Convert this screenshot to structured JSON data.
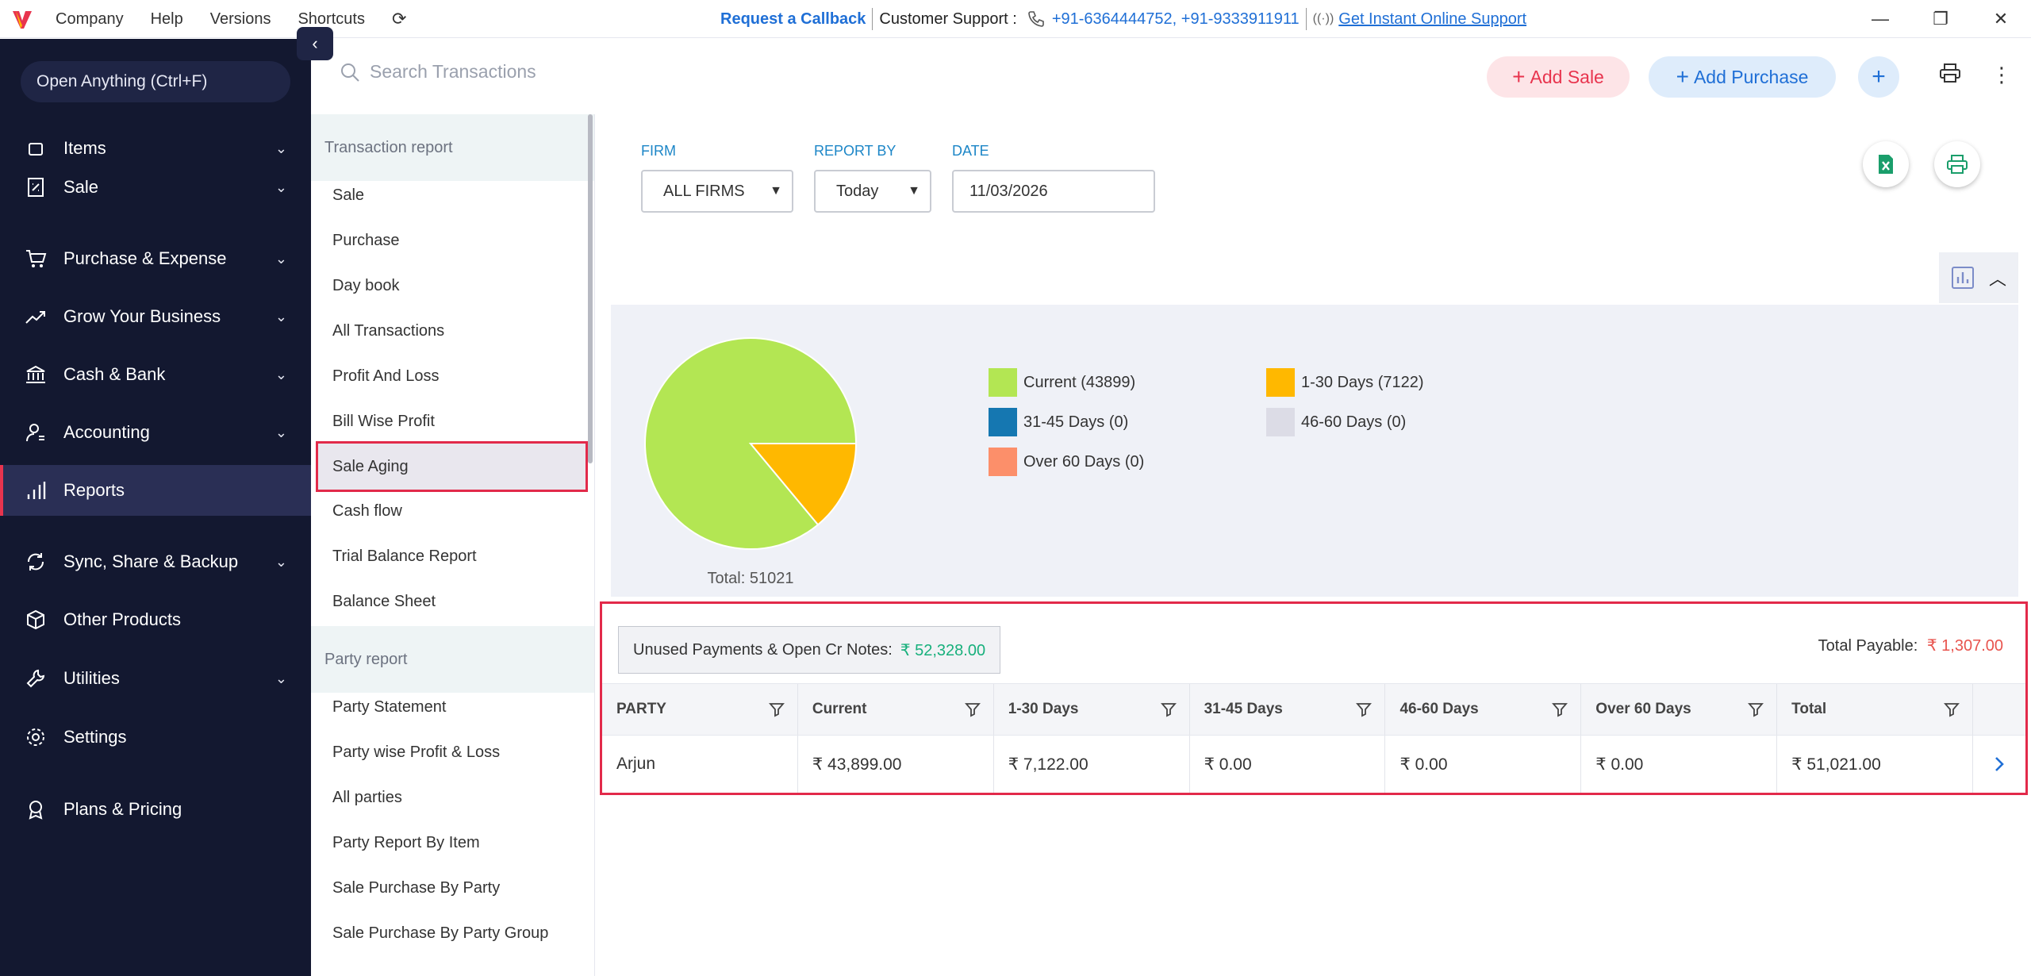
{
  "topbar": {
    "menu": [
      "Company",
      "Help",
      "Versions",
      "Shortcuts"
    ],
    "request_callback": "Request a Callback",
    "support_label": "Customer Support :",
    "support_phones": "+91-6364444752, +91-9333911911",
    "online_support": "Get Instant Online Support"
  },
  "sidebar": {
    "open_anything": "Open Anything (Ctrl+F)",
    "items": [
      {
        "label": "Items",
        "icon": "box-icon"
      },
      {
        "label": "Sale",
        "icon": "receipt-icon"
      },
      {
        "label": "Purchase & Expense",
        "icon": "cart-icon"
      },
      {
        "label": "Grow Your Business",
        "icon": "trend-icon"
      },
      {
        "label": "Cash & Bank",
        "icon": "bank-icon"
      },
      {
        "label": "Accounting",
        "icon": "person-icon"
      },
      {
        "label": "Reports",
        "icon": "bar-chart-icon"
      },
      {
        "label": "Sync, Share & Backup",
        "icon": "sync-icon"
      },
      {
        "label": "Other Products",
        "icon": "cube-icon"
      },
      {
        "label": "Utilities",
        "icon": "wrench-icon"
      },
      {
        "label": "Settings",
        "icon": "gear-icon"
      },
      {
        "label": "Plans & Pricing",
        "icon": "award-icon"
      }
    ]
  },
  "search": {
    "placeholder": "Search Transactions"
  },
  "actions": {
    "add_sale": "Add Sale",
    "add_purchase": "Add Purchase"
  },
  "subnav": {
    "transaction_header": "Transaction report",
    "transaction_items": [
      "Sale",
      "Purchase",
      "Day book",
      "All Transactions",
      "Profit And Loss",
      "Bill Wise Profit",
      "Sale Aging",
      "Cash flow",
      "Trial Balance Report",
      "Balance Sheet"
    ],
    "party_header": "Party report",
    "party_items": [
      "Party Statement",
      "Party wise Profit & Loss",
      "All parties",
      "Party Report By Item",
      "Sale Purchase By Party",
      "Sale Purchase By Party Group"
    ]
  },
  "filters": {
    "firm_label": "FIRM",
    "firm_value": "ALL FIRMS",
    "report_by_label": "REPORT BY",
    "report_by_value": "Today",
    "date_label": "DATE",
    "date_value": "11/03/2026"
  },
  "chart_data": {
    "type": "pie",
    "labels": [
      "Current",
      "1-30 Days",
      "31-45 Days",
      "46-60 Days",
      "Over 60 Days"
    ],
    "values": [
      43899,
      7122,
      0,
      0,
      0
    ],
    "colors": [
      "#b3e653",
      "#ffb800",
      "#1577b1",
      "#dcdce6",
      "#fc8f6a"
    ],
    "legend": [
      "Current (43899)",
      "1-30 Days (7122)",
      "31-45 Days (0)",
      "46-60 Days (0)",
      "Over 60 Days (0)"
    ],
    "total_label": "Total: 51021",
    "legend_position": "right"
  },
  "summary": {
    "unused_label": "Unused Payments & Open Cr Notes:",
    "unused_value": "₹ 52,328.00",
    "payable_label": "Total Payable:",
    "payable_value": "₹ 1,307.00"
  },
  "table": {
    "headers": [
      "PARTY",
      "Current",
      "1-30 Days",
      "31-45 Days",
      "46-60 Days",
      "Over 60 Days",
      "Total"
    ],
    "rows": [
      [
        "Arjun",
        "₹ 43,899.00",
        "₹ 7,122.00",
        "₹ 0.00",
        "₹ 0.00",
        "₹ 0.00",
        "₹ 51,021.00"
      ]
    ]
  }
}
